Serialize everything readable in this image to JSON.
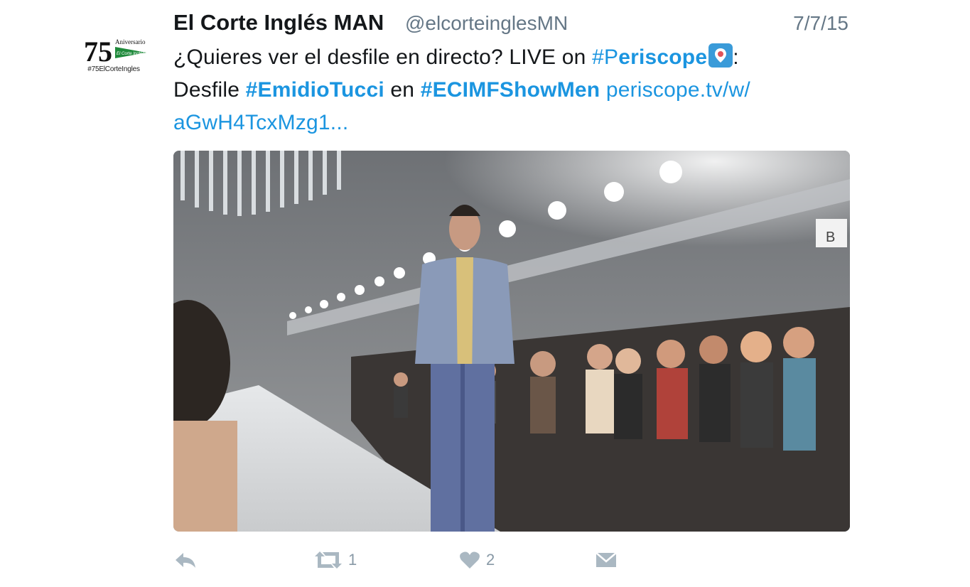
{
  "tweet": {
    "avatar": {
      "number": "75",
      "word": "Aniversario",
      "brand": "El Corte Inglés",
      "hashtag": "#75ElCorteIngles"
    },
    "display_name": "El Corte Inglés MAN",
    "handle": "@elcorteinglesMN",
    "timestamp": "7/7/15",
    "text": {
      "line1_a": "¿Quieres ver el desfile en directo? LIVE on ",
      "line1_hashtag_prefix": "#P",
      "line1_hashtag_rest": "eriscope",
      "line1_end": ":",
      "line2_a": "Desfile ",
      "line2_hashtag1": "#EmidioTucci",
      "line2_b": " en ",
      "line2_hashtag2": "#ECIMFShowMen",
      "line2_link": " periscope.tv/w/",
      "line3_link": "aGwH4TcxMzg1..."
    },
    "media": {
      "alt_icon": "runway-photo",
      "sign_text": "B"
    },
    "actions": {
      "reply_icon": "reply-icon",
      "retweet_icon": "retweet-icon",
      "retweet_count": "1",
      "like_icon": "heart-icon",
      "like_count": "2",
      "dm_icon": "envelope-icon"
    }
  }
}
